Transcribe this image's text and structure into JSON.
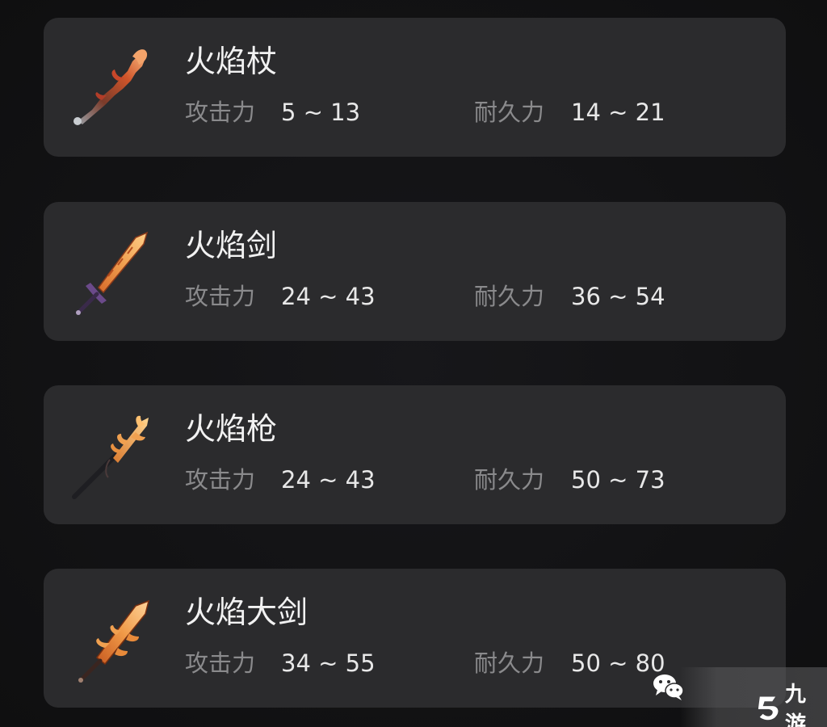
{
  "labels": {
    "attack": "攻击力",
    "durability": "耐久力"
  },
  "items": [
    {
      "name": "火焰杖",
      "attack": "5 ~ 13",
      "durability": "14 ~ 21",
      "icon": "flame-staff-icon"
    },
    {
      "name": "火焰剑",
      "attack": "24 ~ 43",
      "durability": "36 ~ 54",
      "icon": "flame-sword-icon"
    },
    {
      "name": "火焰枪",
      "attack": "24 ~ 43",
      "durability": "50 ~ 73",
      "icon": "flame-spear-icon"
    },
    {
      "name": "火焰大剑",
      "attack": "34 ~ 55",
      "durability": "50 ~ 80",
      "icon": "flame-greatsword-icon"
    }
  ],
  "watermark": {
    "brand": "九游"
  },
  "colors": {
    "card_bg": "#2b2b2d",
    "title": "#f2f2f2",
    "label": "#8a8a8c",
    "value": "#e8e8e8",
    "flame": "#f0a050"
  }
}
